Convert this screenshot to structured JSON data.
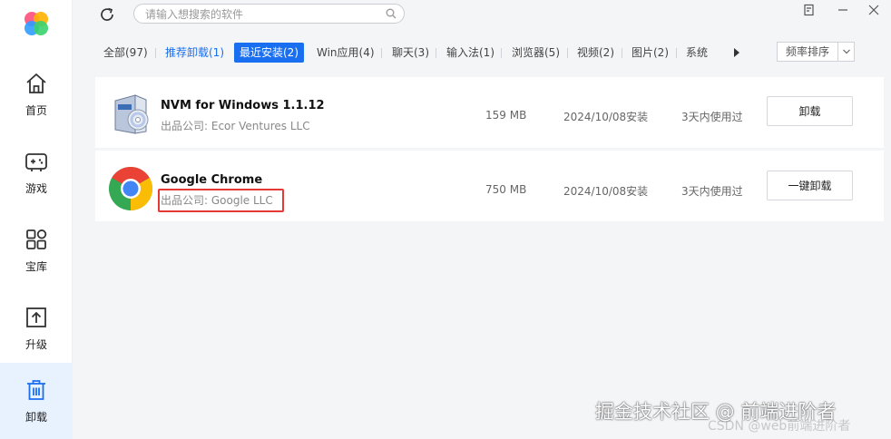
{
  "sidebar": {
    "items": [
      {
        "label": "首页",
        "icon": "home-icon"
      },
      {
        "label": "游戏",
        "icon": "gamepad-icon"
      },
      {
        "label": "宝库",
        "icon": "apps-grid-icon"
      },
      {
        "label": "升级",
        "icon": "upgrade-icon"
      },
      {
        "label": "卸载",
        "icon": "trash-icon",
        "active": true
      }
    ]
  },
  "search": {
    "placeholder": "请输入想搜索的软件"
  },
  "tabs": {
    "items": [
      {
        "label": "全部(97)"
      },
      {
        "label": "推荐卸载(1)"
      },
      {
        "label": "最近安装(2)"
      },
      {
        "label": "Win应用(4)"
      },
      {
        "label": "聊天(3)"
      },
      {
        "label": "输入法(1)"
      },
      {
        "label": "浏览器(5)"
      },
      {
        "label": "视频(2)"
      },
      {
        "label": "图片(2)"
      },
      {
        "label": "系统"
      }
    ],
    "sort_label": "频率排序"
  },
  "apps": [
    {
      "name": "NVM for Windows 1.1.12",
      "publisher": "出品公司: Ecor Ventures LLC",
      "size": "159 MB",
      "install_date": "2024/10/08安装",
      "usage": "3天内使用过",
      "button": "卸载",
      "icon": "software-box-icon"
    },
    {
      "name": "Google Chrome",
      "publisher": "出品公司: Google LLC",
      "size": "750 MB",
      "install_date": "2024/10/08安装",
      "usage": "3天内使用过",
      "button": "一键卸载",
      "icon": "chrome-icon"
    }
  ],
  "watermark": {
    "main": "掘金技术社区 @ 前端进阶者",
    "sub": "CSDN @web前端进阶者"
  },
  "colors": {
    "accent": "#1a6ef0",
    "highlight": "#e53935",
    "sidebar_active": "#e8f2ff"
  }
}
